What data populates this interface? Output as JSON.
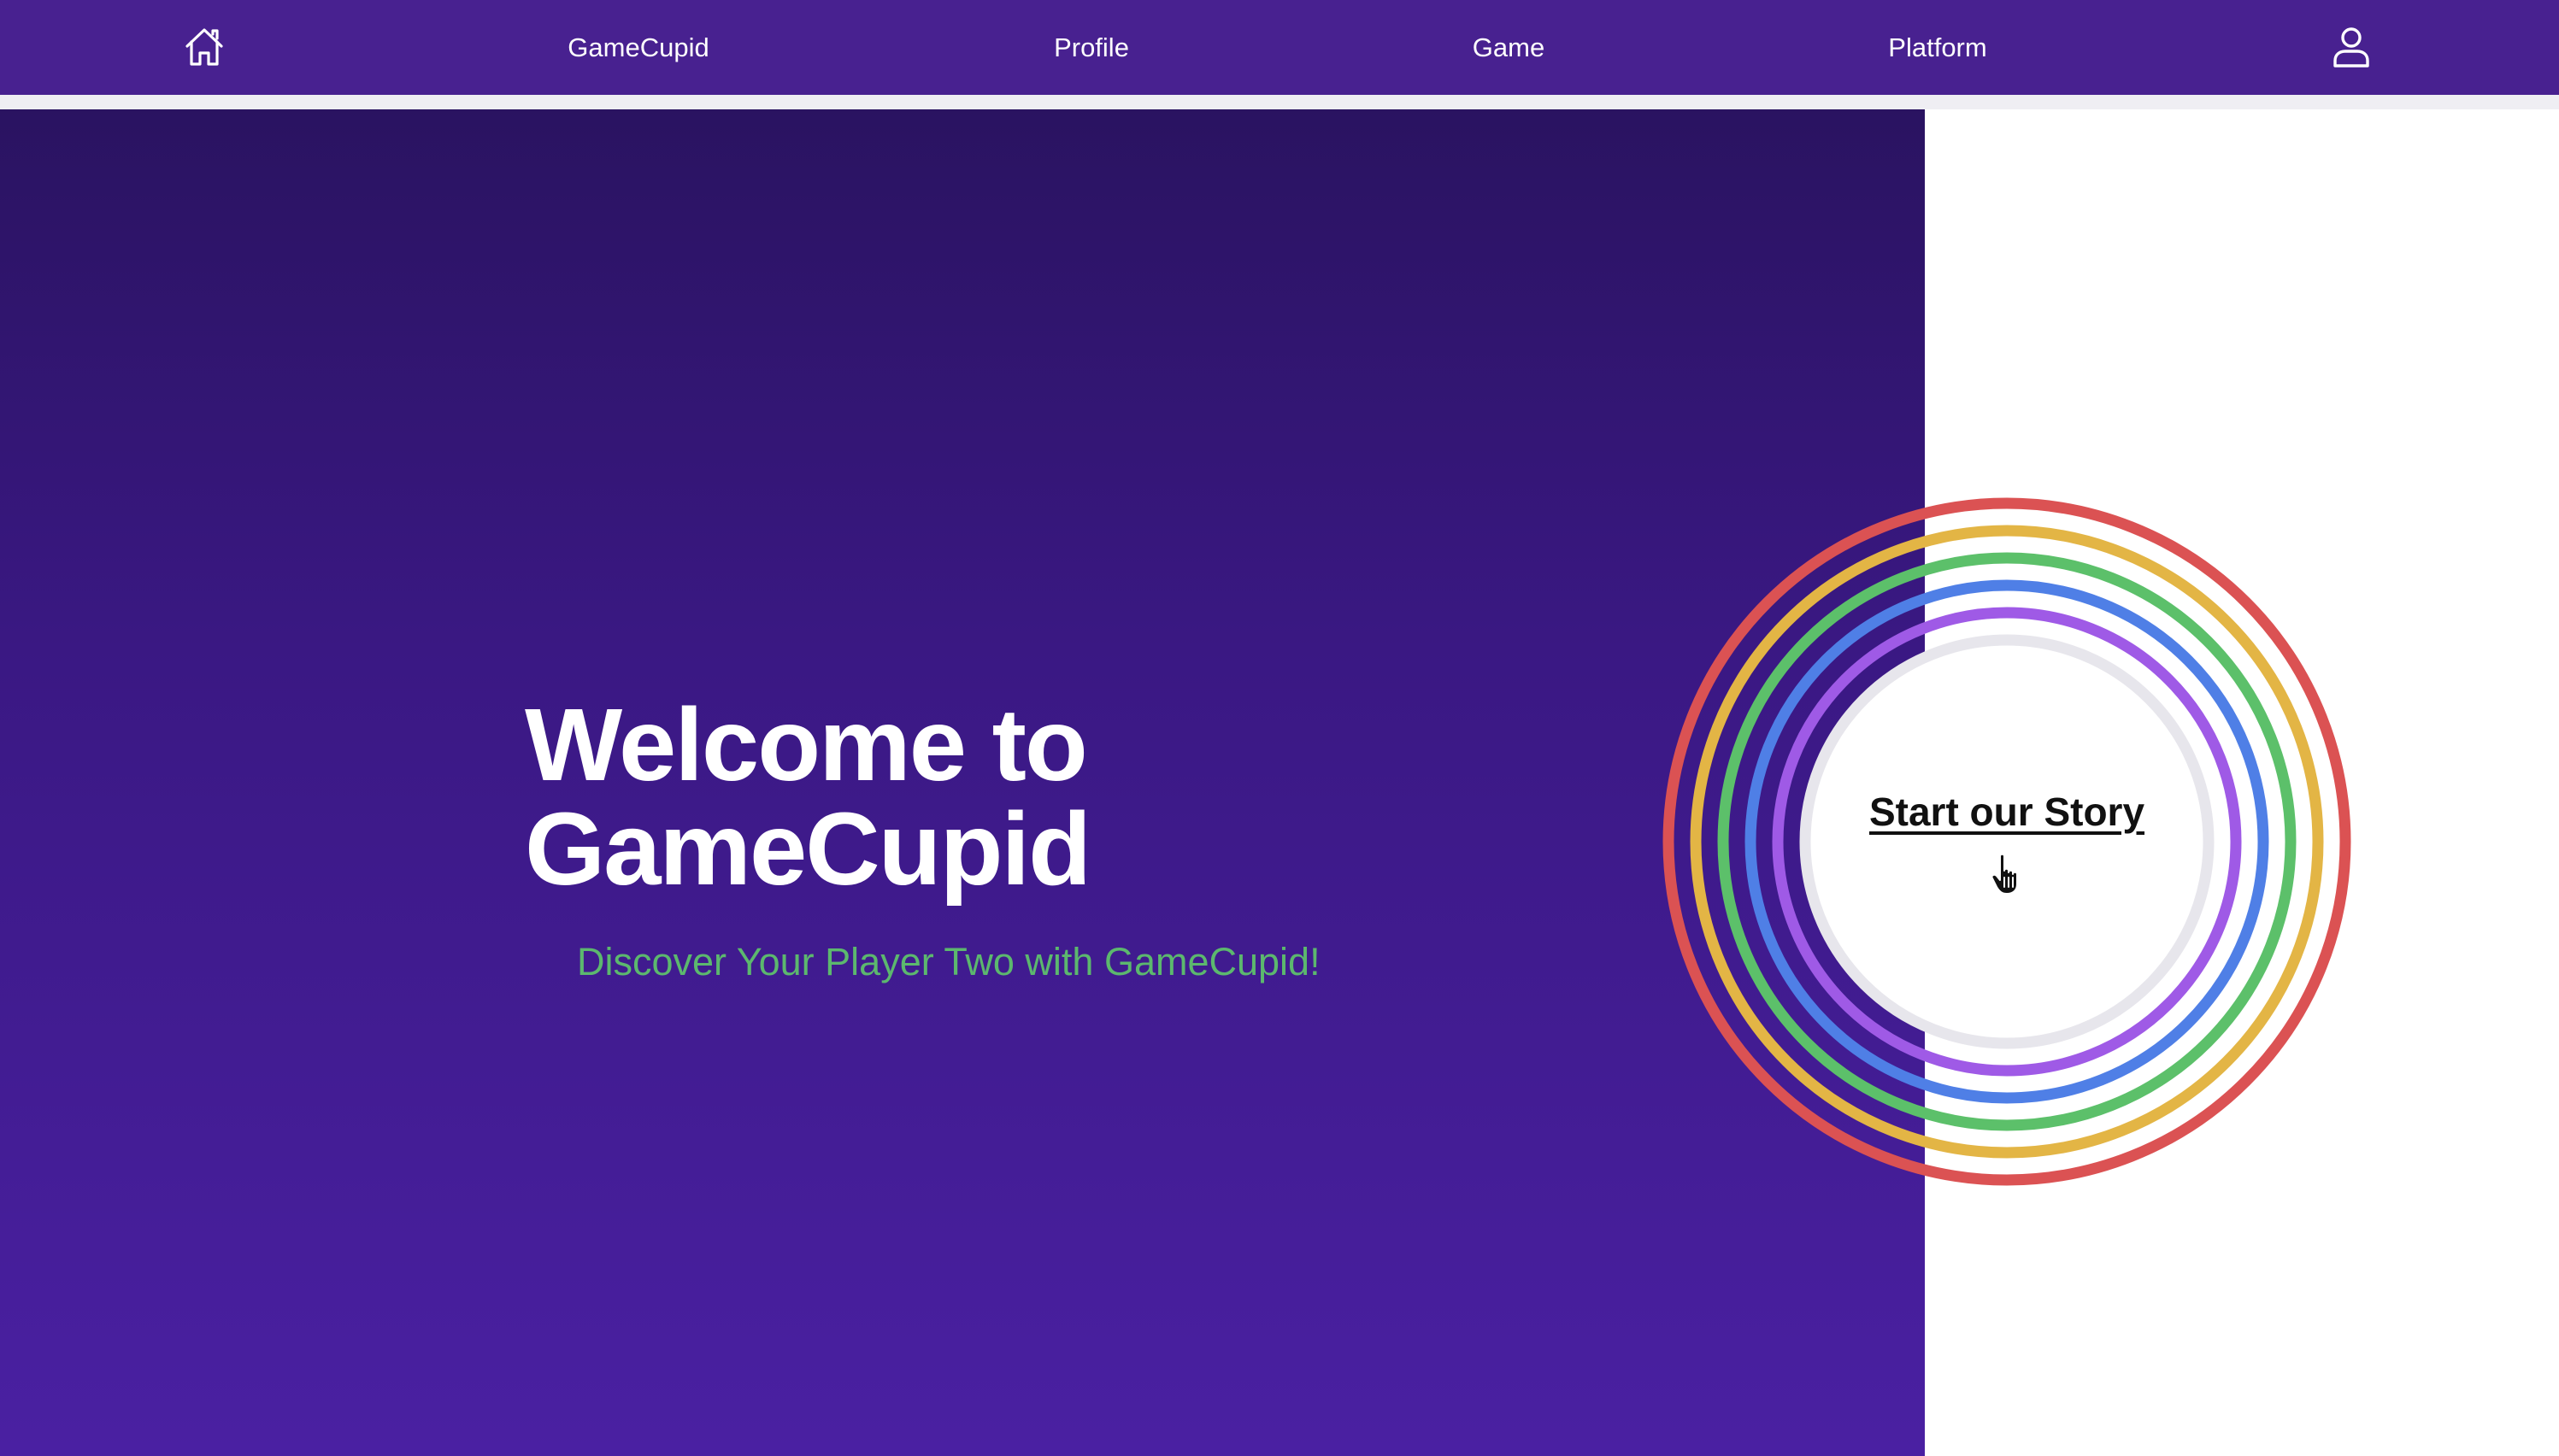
{
  "nav": {
    "home_icon": "home-icon",
    "items": [
      {
        "label": "GameCupid"
      },
      {
        "label": "Profile"
      },
      {
        "label": "Game"
      },
      {
        "label": "Platform"
      }
    ],
    "user_icon": "user-icon",
    "background_color": "#482190"
  },
  "hero": {
    "title_line1": "Welcome to",
    "title_line2": "GameCupid",
    "subtitle": "Discover Your Player Two with GameCupid!",
    "subtitle_color": "#5cb86e"
  },
  "cta": {
    "label": "Start our Story",
    "cursor_icon": "hand-pointer-icon",
    "ring_colors": [
      "#db5253",
      "#e3b545",
      "#5cc06a",
      "#4f7fe6",
      "#9f5ae6",
      "#e7e6ec"
    ]
  }
}
